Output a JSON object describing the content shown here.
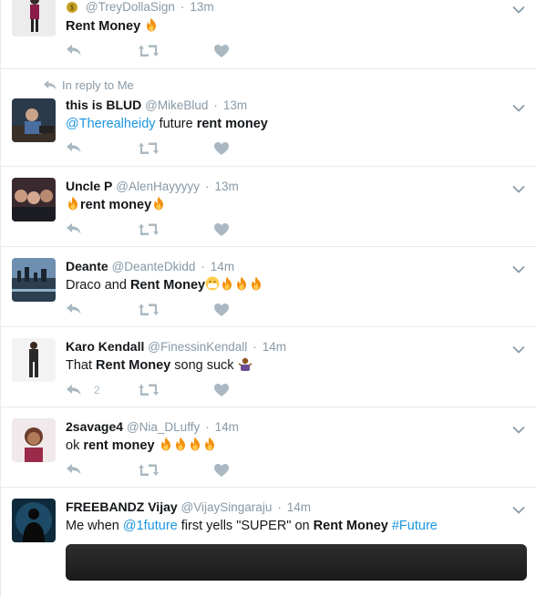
{
  "colors": {
    "link": "#1b95e0",
    "muted": "#8899a6",
    "icon": "#aab8c2",
    "border": "#e6ecf0"
  },
  "tweets": [
    {
      "name": "",
      "handle": "@TreyDollaSign",
      "time": "13m",
      "reply_to": "",
      "reply_count": "",
      "text": [
        "Rent Money"
      ]
    },
    {
      "name": "this is BLUD",
      "handle": "@MikeBlud",
      "time": "13m",
      "reply_to": "In reply to Me",
      "reply_count": "",
      "text": [
        "@Therealheidy",
        "future",
        "rent money"
      ]
    },
    {
      "name": "Uncle P",
      "handle": "@AlenHayyyyy",
      "time": "13m",
      "reply_count": "",
      "text": [
        "rent money"
      ]
    },
    {
      "name": "Deante",
      "handle": "@DeanteDkidd",
      "time": "14m",
      "reply_count": "",
      "text": [
        "Draco and",
        "Rent Money"
      ]
    },
    {
      "name": "Karo Kendall",
      "handle": "@FinessinKendall",
      "time": "14m",
      "reply_count": "2",
      "text": [
        "That",
        "Rent Money",
        "song suck"
      ]
    },
    {
      "name": "2savage4",
      "handle": "@Nia_DLuffy",
      "time": "14m",
      "reply_count": "",
      "text": [
        "ok",
        "rent money"
      ]
    },
    {
      "name": "FREEBANDZ Vijay",
      "handle": "@VijaySingaraju",
      "time": "14m",
      "reply_count": "",
      "text": [
        "Me when",
        "@1future",
        "first yells \"SUPER\" on",
        "Rent Money",
        "#Future"
      ]
    }
  ]
}
